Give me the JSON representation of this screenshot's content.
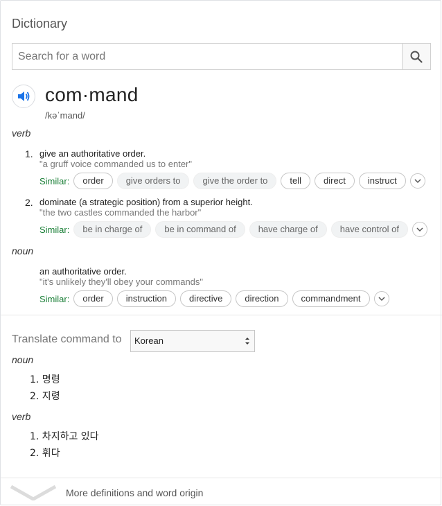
{
  "header": {
    "title": "Dictionary"
  },
  "search": {
    "placeholder": "Search for a word",
    "button_icon": "search-icon"
  },
  "entry": {
    "word": "com·mand",
    "phonetic": "/kəˈmand/"
  },
  "senses": [
    {
      "pos": "verb",
      "defs": [
        {
          "num": "1.",
          "definition": "give an authoritative order.",
          "example": "\"a gruff voice commanded us to enter\"",
          "similar_label": "Similar:",
          "similar": [
            {
              "text": "order",
              "style": "outlined"
            },
            {
              "text": "give orders to",
              "style": "filled"
            },
            {
              "text": "give the order to",
              "style": "filled"
            },
            {
              "text": "tell",
              "style": "outlined"
            },
            {
              "text": "direct",
              "style": "outlined"
            },
            {
              "text": "instruct",
              "style": "outlined"
            }
          ]
        },
        {
          "num": "2.",
          "definition": "dominate (a strategic position) from a superior height.",
          "example": "\"the two castles commanded the harbor\"",
          "similar_label": "Similar:",
          "similar": [
            {
              "text": "be in charge of",
              "style": "filled"
            },
            {
              "text": "be in command of",
              "style": "filled"
            },
            {
              "text": "have charge of",
              "style": "filled"
            },
            {
              "text": "have control of",
              "style": "filled"
            }
          ]
        }
      ]
    },
    {
      "pos": "noun",
      "defs": [
        {
          "num": "",
          "definition": "an authoritative order.",
          "example": "\"it's unlikely they'll obey your commands\"",
          "similar_label": "Similar:",
          "similar": [
            {
              "text": "order",
              "style": "outlined"
            },
            {
              "text": "instruction",
              "style": "outlined"
            },
            {
              "text": "directive",
              "style": "outlined"
            },
            {
              "text": "direction",
              "style": "outlined"
            },
            {
              "text": "commandment",
              "style": "outlined"
            }
          ]
        }
      ]
    }
  ],
  "translate": {
    "label": "Translate command to",
    "selected_language": "Korean",
    "groups": [
      {
        "pos": "noun",
        "items": [
          "1. 명령",
          "2. 지령"
        ]
      },
      {
        "pos": "verb",
        "items": [
          "1. 차지하고 있다",
          "2. 휘다"
        ]
      }
    ]
  },
  "footer": {
    "more_label": "More definitions and word origin"
  },
  "colors": {
    "similar_label": "#1a7f37",
    "speaker_blue": "#1a73e8"
  }
}
